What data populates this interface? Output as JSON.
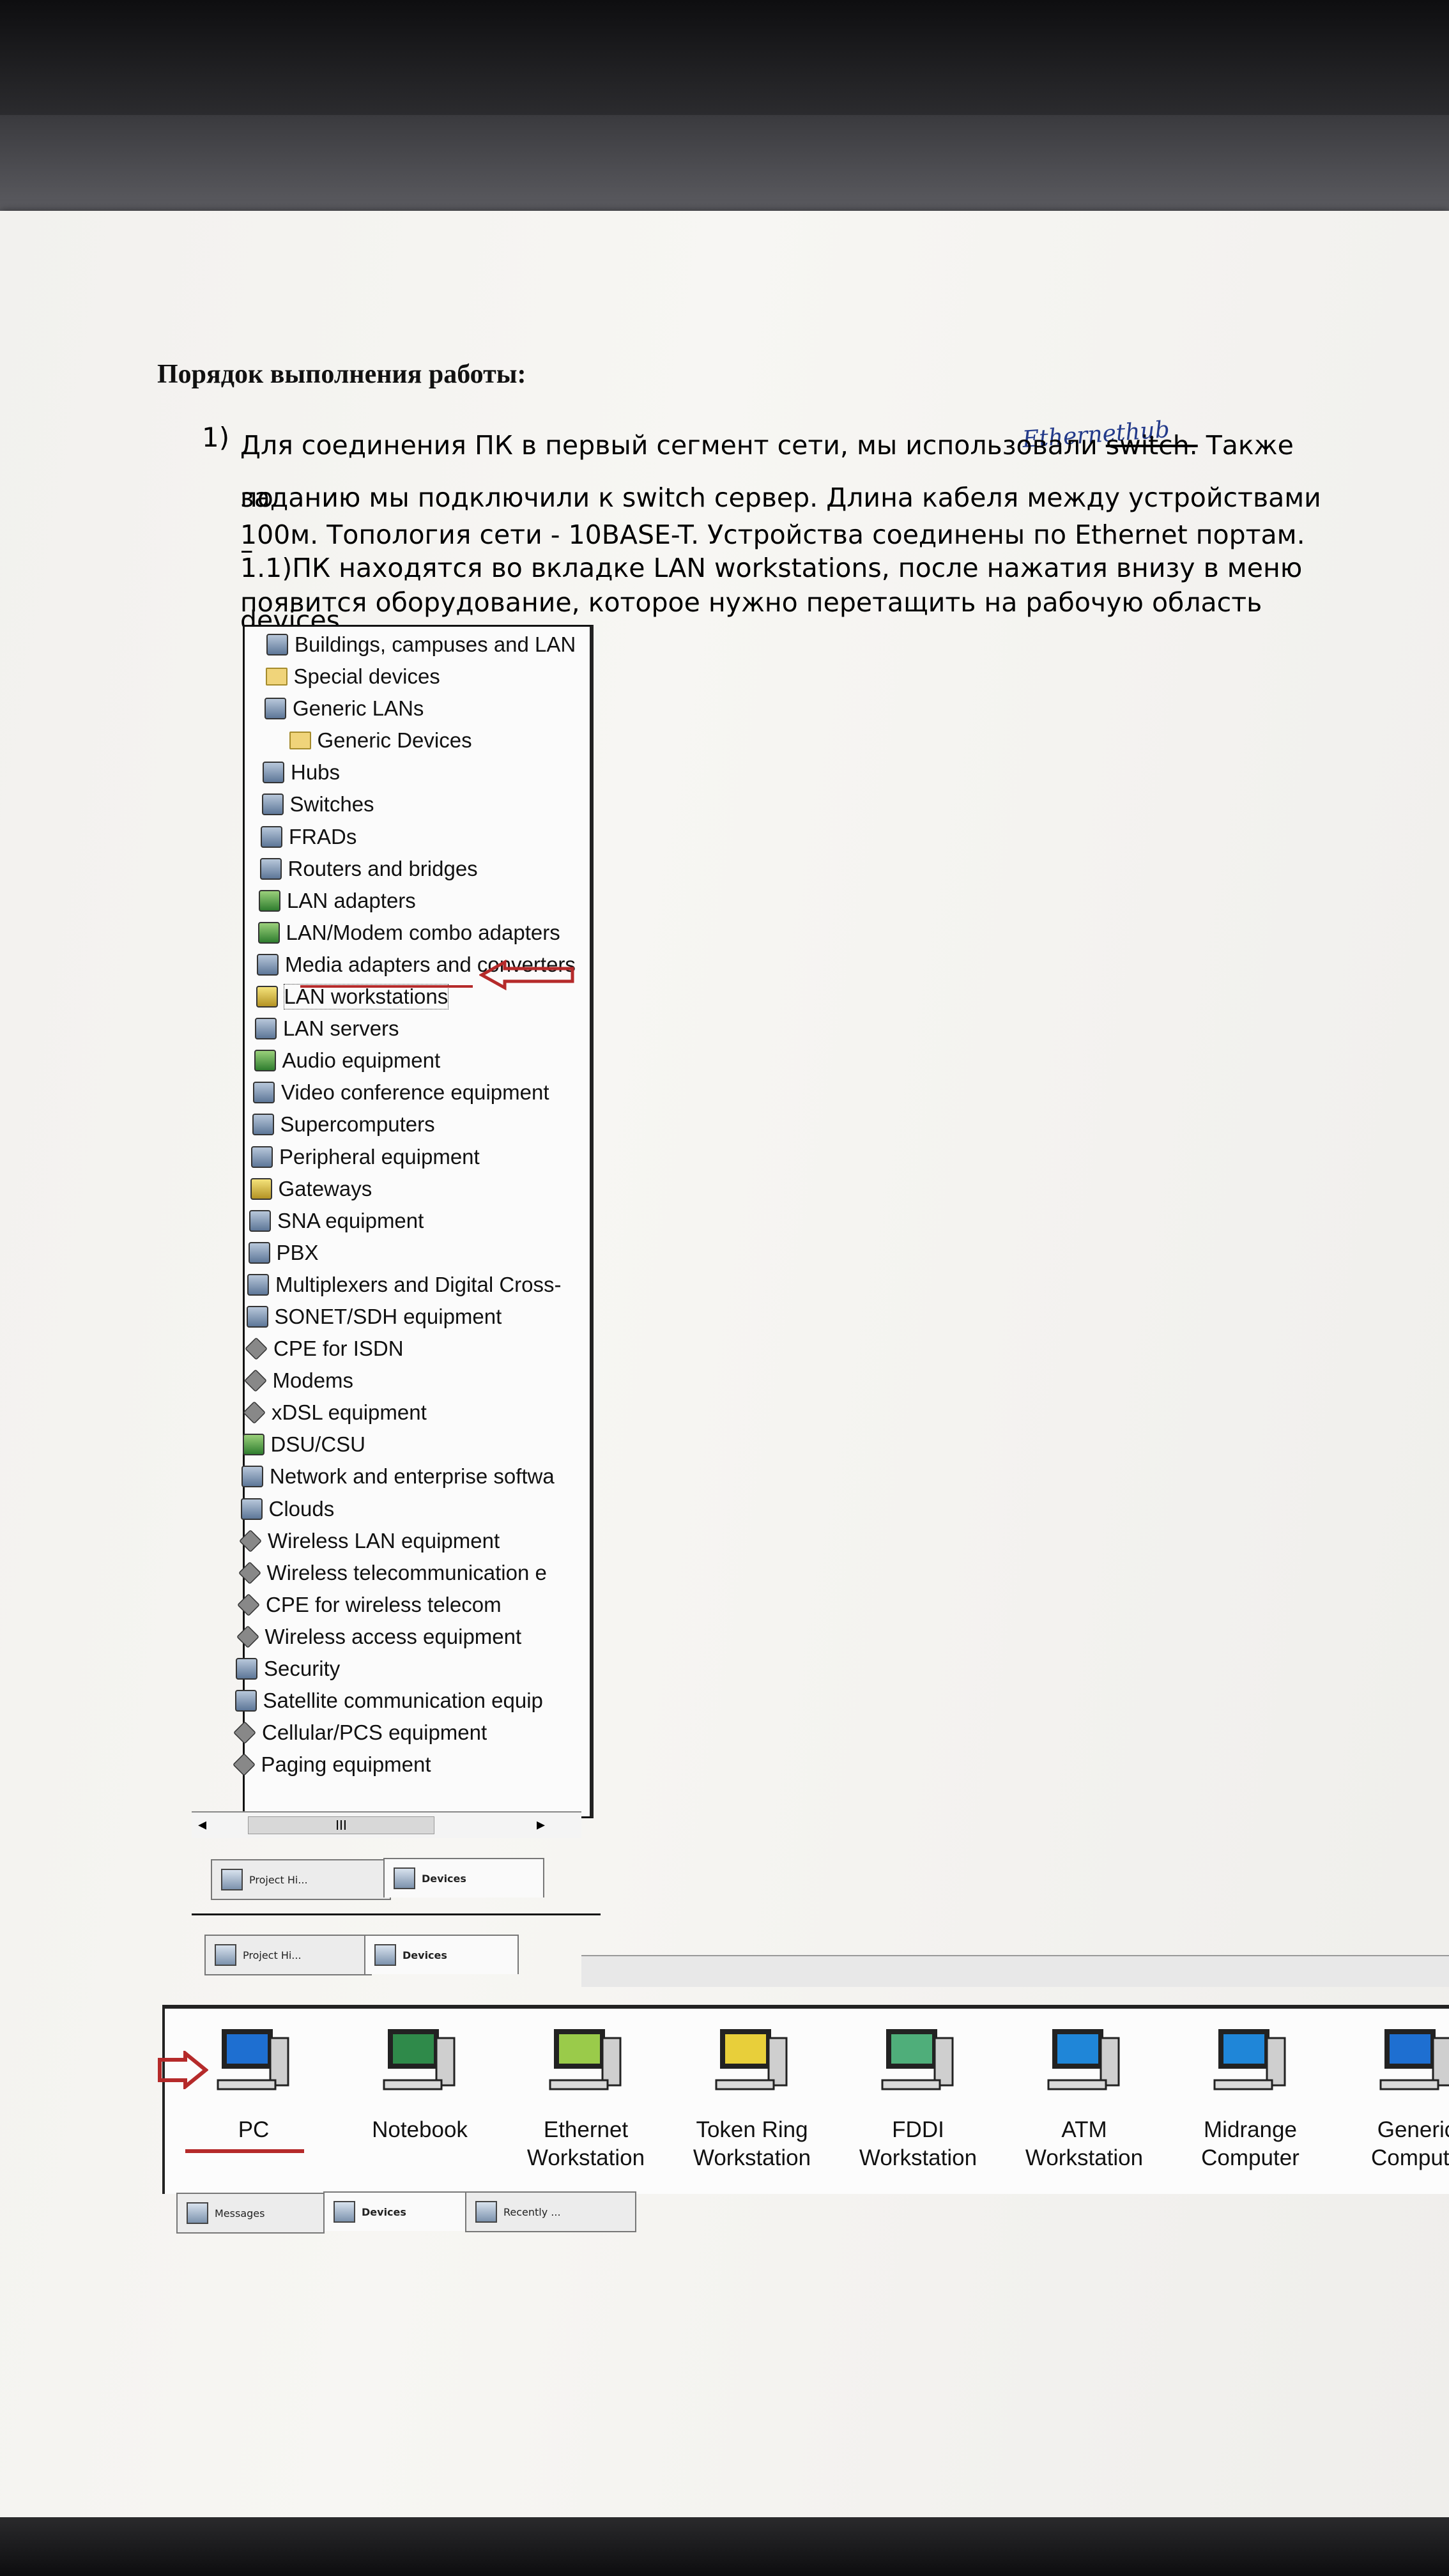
{
  "document": {
    "heading": "Порядок выполнения работы:",
    "item_number": "1)",
    "para_lines": [
      "Для соединения ПК в первый сегмент сети, мы использовали ",
      "заданию мы подключили к switch сервер. Длина кабеля между устройствами –",
      "100м. Топология сети - 10BASE-T.  Устройства соединены по Ethernet портам.",
      "1.1)ПК находятся во вкладке LAN workstations, после нажатия внизу в меню devices",
      "появится оборудование, которое нужно перетащить на рабочую область"
    ],
    "struck_word": "switch.",
    "after_struck": " Также по",
    "handwritten_note": "Ethernethub"
  },
  "tree": {
    "items": [
      {
        "label": "Buildings, campuses and LAN",
        "icon": "building-icon"
      },
      {
        "label": "Special devices",
        "icon": "folder-icon"
      },
      {
        "label": "Generic LANs",
        "icon": "lan-icon"
      },
      {
        "label": "Generic Devices",
        "icon": "folder-icon"
      },
      {
        "label": "Hubs",
        "icon": "hub-icon"
      },
      {
        "label": "Switches",
        "icon": "switch-icon"
      },
      {
        "label": "FRADs",
        "icon": "frad-icon"
      },
      {
        "label": "Routers and bridges",
        "icon": "router-icon"
      },
      {
        "label": "LAN adapters",
        "icon": "lan-adapter-icon"
      },
      {
        "label": "LAN/Modem combo adapters",
        "icon": "combo-adapter-icon"
      },
      {
        "label": "Media adapters and converters",
        "icon": "media-adapter-icon"
      },
      {
        "label": "LAN workstations",
        "icon": "workstation-icon"
      },
      {
        "label": "LAN servers",
        "icon": "server-icon"
      },
      {
        "label": "Audio equipment",
        "icon": "audio-icon"
      },
      {
        "label": "Video conference equipment",
        "icon": "video-conference-icon"
      },
      {
        "label": "Supercomputers",
        "icon": "supercomputer-icon"
      },
      {
        "label": "Peripheral equipment",
        "icon": "peripheral-icon"
      },
      {
        "label": "Gateways",
        "icon": "gateway-icon"
      },
      {
        "label": "SNA equipment",
        "icon": "sna-icon"
      },
      {
        "label": "PBX",
        "icon": "pbx-icon"
      },
      {
        "label": "Multiplexers and Digital Cross-",
        "icon": "multiplexer-icon"
      },
      {
        "label": "SONET/SDH equipment",
        "icon": "sonet-icon"
      },
      {
        "label": "CPE for ISDN",
        "icon": "isdn-icon"
      },
      {
        "label": "Modems",
        "icon": "modem-icon"
      },
      {
        "label": "xDSL equipment",
        "icon": "xdsl-icon"
      },
      {
        "label": "DSU/CSU",
        "icon": "dsu-icon"
      },
      {
        "label": "Network and enterprise softwa",
        "icon": "software-icon"
      },
      {
        "label": "Clouds",
        "icon": "cloud-icon"
      },
      {
        "label": "Wireless LAN equipment",
        "icon": "wireless-lan-icon"
      },
      {
        "label": "Wireless telecommunication e",
        "icon": "wireless-telecom-icon"
      },
      {
        "label": "CPE for wireless telecom",
        "icon": "wireless-cpe-icon"
      },
      {
        "label": "Wireless access equipment",
        "icon": "wireless-access-icon"
      },
      {
        "label": "Security",
        "icon": "security-icon"
      },
      {
        "label": "Satellite communication equip",
        "icon": "satellite-icon"
      },
      {
        "label": "Cellular/PCS equipment",
        "icon": "cellular-icon"
      },
      {
        "label": "Paging equipment",
        "icon": "paging-icon"
      }
    ],
    "scroll_thumb": "III",
    "tabs_a": [
      "Project Hi...",
      "Devices"
    ],
    "tabs_b": [
      "Project Hi...",
      "Devices"
    ]
  },
  "devices": {
    "items": [
      {
        "label": "PC",
        "icon": "pc-icon"
      },
      {
        "label": "Notebook",
        "icon": "notebook-icon"
      },
      {
        "label": "Ethernet\nWorkstation",
        "icon": "ethernet-workstation-icon"
      },
      {
        "label": "Token Ring\nWorkstation",
        "icon": "token-ring-workstation-icon"
      },
      {
        "label": "FDDI\nWorkstation",
        "icon": "fddi-workstation-icon"
      },
      {
        "label": "ATM\nWorkstation",
        "icon": "atm-workstation-icon"
      },
      {
        "label": "Midrange\nComputer",
        "icon": "midrange-computer-icon"
      },
      {
        "label": "Generic\nCompute",
        "icon": "generic-computer-icon"
      }
    ],
    "bottom_tabs": [
      "Messages",
      "Devices",
      "Recently ..."
    ]
  },
  "colors": {
    "annotation_red": "#b52a2a",
    "handwriting_blue": "#233a8a"
  }
}
